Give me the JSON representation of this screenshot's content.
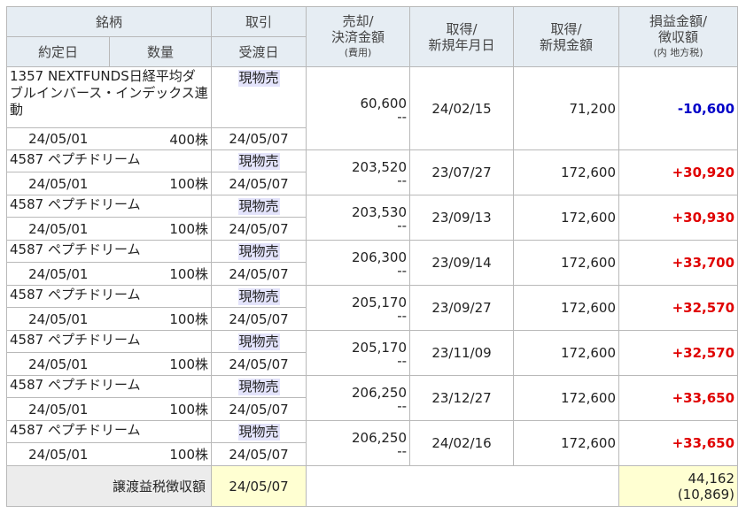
{
  "header": {
    "meigara": "銘柄",
    "torihiki": "取引",
    "baikyaku_l1": "売却/",
    "baikyaku_l2": "決済金額",
    "baikyaku_l3": "(費用)",
    "shutoku_date_l1": "取得/",
    "shutoku_date_l2": "新規年月日",
    "shutoku_amt_l1": "取得/",
    "shutoku_amt_l2": "新規金額",
    "pl_l1": "損益金額/",
    "pl_l2": "徴収額",
    "pl_l3": "(内 地方税)",
    "yakujobi": "約定日",
    "suryo": "数量",
    "ukewatashi": "受渡日"
  },
  "rows": [
    {
      "name": "1357 NEXTFUNDS日経平均ダブルインバース・インデックス連動",
      "trade": "現物売",
      "sale": "60,600",
      "fee": "--",
      "acq_date": "24/02/15",
      "acq_amount": "71,200",
      "pl": "-10,600",
      "pl_sign": "minus",
      "exec_date": "24/05/01",
      "qty": "400株",
      "settle_date": "24/05/07"
    },
    {
      "name": "4587 ペプチドリーム",
      "trade": "現物売",
      "sale": "203,520",
      "fee": "--",
      "acq_date": "23/07/27",
      "acq_amount": "172,600",
      "pl": "+30,920",
      "pl_sign": "plus",
      "exec_date": "24/05/01",
      "qty": "100株",
      "settle_date": "24/05/07"
    },
    {
      "name": "4587 ペプチドリーム",
      "trade": "現物売",
      "sale": "203,530",
      "fee": "--",
      "acq_date": "23/09/13",
      "acq_amount": "172,600",
      "pl": "+30,930",
      "pl_sign": "plus",
      "exec_date": "24/05/01",
      "qty": "100株",
      "settle_date": "24/05/07"
    },
    {
      "name": "4587 ペプチドリーム",
      "trade": "現物売",
      "sale": "206,300",
      "fee": "--",
      "acq_date": "23/09/14",
      "acq_amount": "172,600",
      "pl": "+33,700",
      "pl_sign": "plus",
      "exec_date": "24/05/01",
      "qty": "100株",
      "settle_date": "24/05/07"
    },
    {
      "name": "4587 ペプチドリーム",
      "trade": "現物売",
      "sale": "205,170",
      "fee": "--",
      "acq_date": "23/09/27",
      "acq_amount": "172,600",
      "pl": "+32,570",
      "pl_sign": "plus",
      "exec_date": "24/05/01",
      "qty": "100株",
      "settle_date": "24/05/07"
    },
    {
      "name": "4587 ペプチドリーム",
      "trade": "現物売",
      "sale": "205,170",
      "fee": "--",
      "acq_date": "23/11/09",
      "acq_amount": "172,600",
      "pl": "+32,570",
      "pl_sign": "plus",
      "exec_date": "24/05/01",
      "qty": "100株",
      "settle_date": "24/05/07"
    },
    {
      "name": "4587 ペプチドリーム",
      "trade": "現物売",
      "sale": "206,250",
      "fee": "--",
      "acq_date": "23/12/27",
      "acq_amount": "172,600",
      "pl": "+33,650",
      "pl_sign": "plus",
      "exec_date": "24/05/01",
      "qty": "100株",
      "settle_date": "24/05/07"
    },
    {
      "name": "4587 ペプチドリーム",
      "trade": "現物売",
      "sale": "206,250",
      "fee": "--",
      "acq_date": "24/02/16",
      "acq_amount": "172,600",
      "pl": "+33,650",
      "pl_sign": "plus",
      "exec_date": "24/05/01",
      "qty": "100株",
      "settle_date": "24/05/07"
    }
  ],
  "total": {
    "label": "譲渡益税徴収額",
    "date": "24/05/07",
    "amount": "44,162",
    "local_tax": "(10,869)"
  },
  "colors": {
    "header_bg": "#e6edf3",
    "minus": "#0000c8",
    "plus": "#e00000",
    "trade_bg": "#e3e3fb",
    "total_bg": "#ffffd2"
  }
}
